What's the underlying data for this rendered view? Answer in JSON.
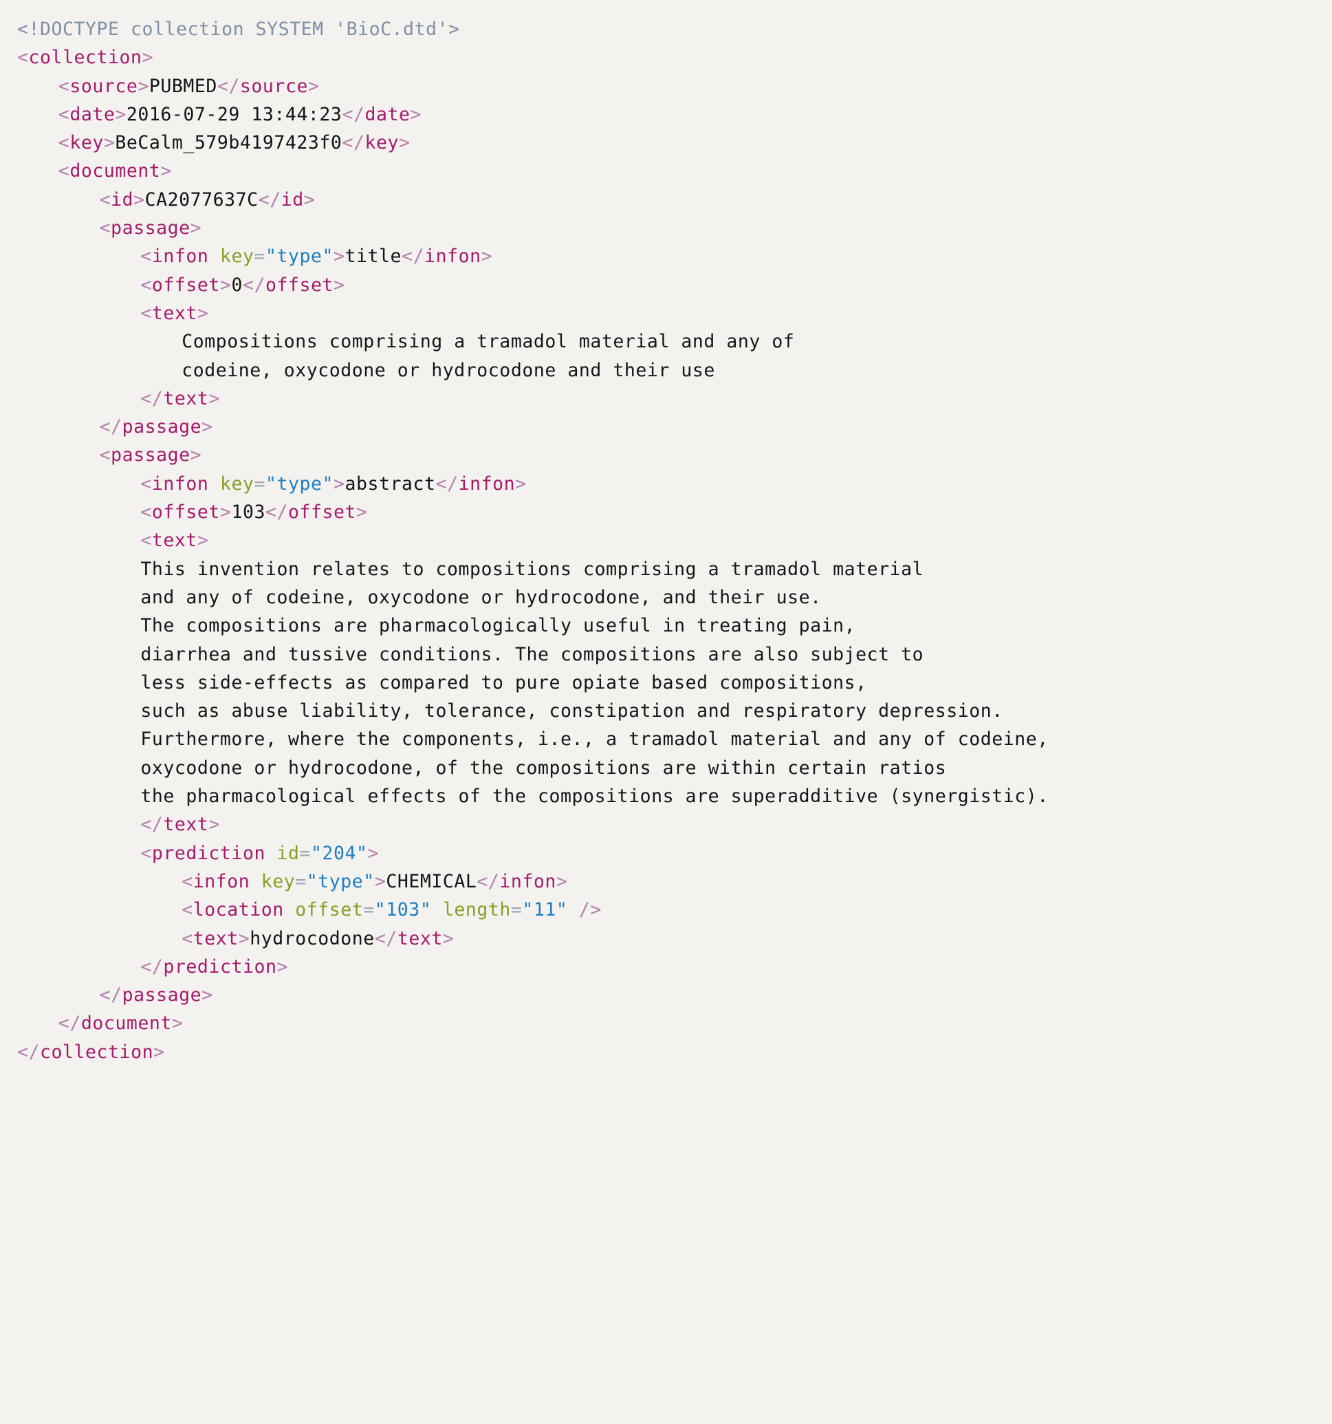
{
  "document_type": "xml-source-listing",
  "colors": {
    "background": "#f4f2ee",
    "doctype": "#7f90a8",
    "bracket": "#b67fb0",
    "tag_name": "#a51a6e",
    "attribute_name": "#87a025",
    "attribute_value": "#1f7fc4",
    "text_content": "#141414"
  },
  "lines": [
    {
      "n": 1,
      "indent": 0,
      "kind": "doctype",
      "raw": "<!DOCTYPE collection SYSTEM 'BioC.dtd'>"
    },
    {
      "n": 2,
      "indent": 0,
      "kind": "open-tag",
      "tag": "collection"
    },
    {
      "n": 3,
      "indent": 1,
      "kind": "element",
      "tag": "source",
      "value": "PUBMED"
    },
    {
      "n": 4,
      "indent": 1,
      "kind": "element",
      "tag": "date",
      "value": "2016-07-29 13:44:23"
    },
    {
      "n": 5,
      "indent": 1,
      "kind": "element",
      "tag": "key",
      "value": "BeCalm_579b4197423f0"
    },
    {
      "n": 6,
      "indent": 1,
      "kind": "open-tag",
      "tag": "document"
    },
    {
      "n": 7,
      "indent": 2,
      "kind": "element",
      "tag": "id",
      "value": "CA2077637C"
    },
    {
      "n": 8,
      "indent": 2,
      "kind": "open-tag",
      "tag": "passage"
    },
    {
      "n": 9,
      "indent": 3,
      "kind": "element-attr",
      "tag": "infon",
      "attrs": [
        {
          "name": "key",
          "value": "type"
        }
      ],
      "value": "title"
    },
    {
      "n": 10,
      "indent": 3,
      "kind": "element",
      "tag": "offset",
      "value": "0"
    },
    {
      "n": 11,
      "indent": 3,
      "kind": "open-tag",
      "tag": "text"
    },
    {
      "n": 12,
      "indent": 4,
      "kind": "body",
      "value": "Compositions comprising a tramadol material and any of"
    },
    {
      "n": 13,
      "indent": 4,
      "kind": "body",
      "value": "codeine, oxycodone or hydrocodone and their use"
    },
    {
      "n": 14,
      "indent": 3,
      "kind": "close-tag",
      "tag": "text"
    },
    {
      "n": 15,
      "indent": 2,
      "kind": "close-tag",
      "tag": "passage"
    },
    {
      "n": 16,
      "indent": 2,
      "kind": "open-tag",
      "tag": "passage"
    },
    {
      "n": 17,
      "indent": 3,
      "kind": "element-attr",
      "tag": "infon",
      "attrs": [
        {
          "name": "key",
          "value": "type"
        }
      ],
      "value": "abstract"
    },
    {
      "n": 18,
      "indent": 3,
      "kind": "element",
      "tag": "offset",
      "value": "103"
    },
    {
      "n": 19,
      "indent": 3,
      "kind": "open-tag",
      "tag": "text"
    },
    {
      "n": 20,
      "indent": 3,
      "kind": "body",
      "value": "This invention relates to compositions comprising a tramadol material"
    },
    {
      "n": 21,
      "indent": 3,
      "kind": "body",
      "value": "and any of codeine, oxycodone or hydrocodone, and their use."
    },
    {
      "n": 22,
      "indent": 3,
      "kind": "body",
      "value": "The compositions are pharmacologically useful in treating pain,"
    },
    {
      "n": 23,
      "indent": 3,
      "kind": "body",
      "value": "diarrhea and tussive conditions. The compositions are also subject to"
    },
    {
      "n": 24,
      "indent": 3,
      "kind": "body",
      "value": "less side-effects as compared to pure opiate based compositions,"
    },
    {
      "n": 25,
      "indent": 3,
      "kind": "body",
      "value": "such as abuse liability, tolerance, constipation and respiratory depression."
    },
    {
      "n": 26,
      "indent": 3,
      "kind": "body",
      "value": "Furthermore, where the components, i.e., a tramadol material and any of codeine,"
    },
    {
      "n": 27,
      "indent": 3,
      "kind": "body",
      "value": "oxycodone or hydrocodone, of the compositions are within certain ratios"
    },
    {
      "n": 28,
      "indent": 3,
      "kind": "body",
      "value": "the pharmacological effects of the compositions are superadditive (synergistic)."
    },
    {
      "n": 29,
      "indent": 3,
      "kind": "close-tag",
      "tag": "text"
    },
    {
      "n": 30,
      "indent": 3,
      "kind": "open-tag-attr",
      "tag": "prediction",
      "attrs": [
        {
          "name": "id",
          "value": "204"
        }
      ]
    },
    {
      "n": 31,
      "indent": 4,
      "kind": "element-attr",
      "tag": "infon",
      "attrs": [
        {
          "name": "key",
          "value": "type"
        }
      ],
      "value": "CHEMICAL"
    },
    {
      "n": 32,
      "indent": 4,
      "kind": "selfclose-tag",
      "tag": "location",
      "attrs": [
        {
          "name": "offset",
          "value": "103"
        },
        {
          "name": "length",
          "value": "11"
        }
      ]
    },
    {
      "n": 33,
      "indent": 4,
      "kind": "element",
      "tag": "text",
      "value": "hydrocodone"
    },
    {
      "n": 34,
      "indent": 3,
      "kind": "close-tag",
      "tag": "prediction"
    },
    {
      "n": 35,
      "indent": 2,
      "kind": "close-tag",
      "tag": "passage"
    },
    {
      "n": 36,
      "indent": 1,
      "kind": "close-tag",
      "tag": "document"
    },
    {
      "n": 37,
      "indent": 0,
      "kind": "close-tag",
      "tag": "collection"
    }
  ]
}
